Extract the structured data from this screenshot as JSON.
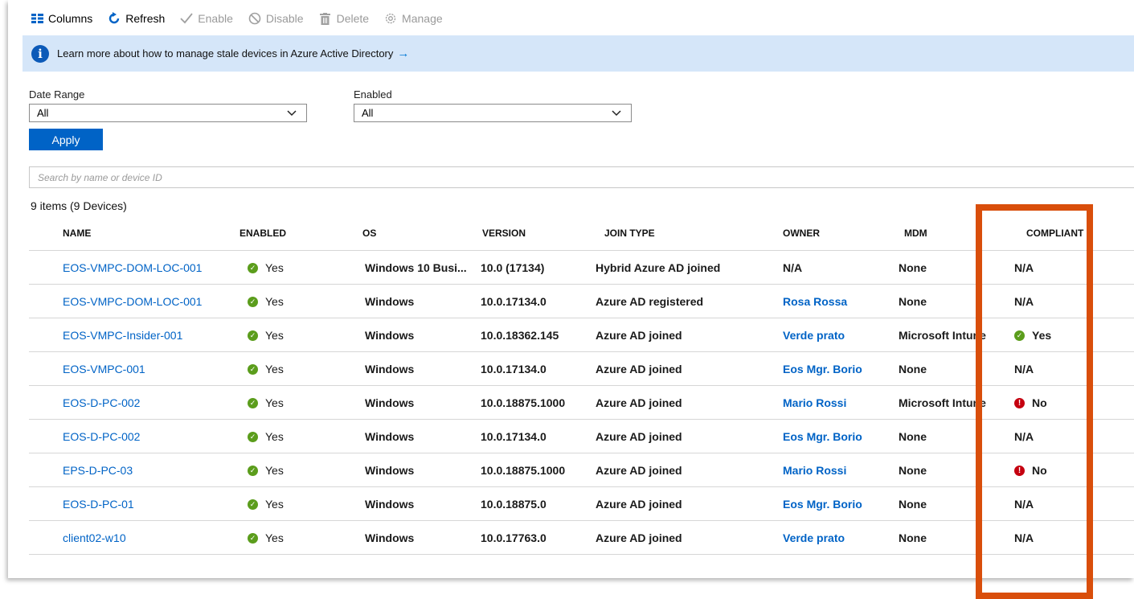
{
  "toolbar": {
    "columns": "Columns",
    "refresh": "Refresh",
    "enable": "Enable",
    "disable": "Disable",
    "delete": "Delete",
    "manage": "Manage"
  },
  "banner": {
    "text": "Learn more about how to manage stale devices in Azure Active Directory",
    "arrow": "→"
  },
  "filters": {
    "date_range_label": "Date Range",
    "date_range_value": "All",
    "enabled_label": "Enabled",
    "enabled_value": "All",
    "apply": "Apply"
  },
  "search": {
    "placeholder": "Search by name or device ID"
  },
  "count": "9 items (9 Devices)",
  "columns": [
    "NAME",
    "ENABLED",
    "OS",
    "VERSION",
    "JOIN TYPE",
    "OWNER",
    "MDM",
    "COMPLIANT"
  ],
  "rows": [
    {
      "name": "EOS-VMPC-DOM-LOC-001",
      "enabled": "Yes",
      "os": "Windows 10 Busi...",
      "version": "10.0 (17134)",
      "join": "Hybrid Azure AD joined",
      "owner": "N/A",
      "owner_link": false,
      "mdm": "None",
      "compliant": "N/A",
      "compliant_status": "none"
    },
    {
      "name": "EOS-VMPC-DOM-LOC-001",
      "enabled": "Yes",
      "os": "Windows",
      "version": "10.0.17134.0",
      "join": "Azure AD registered",
      "owner": "Rosa Rossa",
      "owner_link": true,
      "mdm": "None",
      "compliant": "N/A",
      "compliant_status": "none"
    },
    {
      "name": "EOS-VMPC-Insider-001",
      "enabled": "Yes",
      "os": "Windows",
      "version": "10.0.18362.145",
      "join": "Azure AD joined",
      "owner": "Verde prato",
      "owner_link": true,
      "mdm": "Microsoft Intune",
      "compliant": "Yes",
      "compliant_status": "ok"
    },
    {
      "name": "EOS-VMPC-001",
      "enabled": "Yes",
      "os": "Windows",
      "version": "10.0.17134.0",
      "join": "Azure AD joined",
      "owner": "Eos Mgr. Borio",
      "owner_link": true,
      "mdm": "None",
      "compliant": "N/A",
      "compliant_status": "none"
    },
    {
      "name": "EOS-D-PC-002",
      "enabled": "Yes",
      "os": "Windows",
      "version": "10.0.18875.1000",
      "join": "Azure AD joined",
      "owner": "Mario Rossi",
      "owner_link": true,
      "mdm": "Microsoft Intune",
      "compliant": "No",
      "compliant_status": "bad"
    },
    {
      "name": "EOS-D-PC-002",
      "enabled": "Yes",
      "os": "Windows",
      "version": "10.0.17134.0",
      "join": "Azure AD joined",
      "owner": "Eos Mgr. Borio",
      "owner_link": true,
      "mdm": "None",
      "compliant": "N/A",
      "compliant_status": "none"
    },
    {
      "name": "EPS-D-PC-03",
      "enabled": "Yes",
      "os": "Windows",
      "version": "10.0.18875.1000",
      "join": "Azure AD joined",
      "owner": "Mario Rossi",
      "owner_link": true,
      "mdm": "None",
      "compliant": "No",
      "compliant_status": "bad"
    },
    {
      "name": "EOS-D-PC-01",
      "enabled": "Yes",
      "os": "Windows",
      "version": "10.0.18875.0",
      "join": "Azure AD joined",
      "owner": "Eos Mgr. Borio",
      "owner_link": true,
      "mdm": "None",
      "compliant": "N/A",
      "compliant_status": "none"
    },
    {
      "name": "client02-w10",
      "enabled": "Yes",
      "os": "Windows",
      "version": "10.0.17763.0",
      "join": "Azure AD joined",
      "owner": "Verde prato",
      "owner_link": true,
      "mdm": "None",
      "compliant": "N/A",
      "compliant_status": "none"
    }
  ],
  "colors": {
    "accent": "#0063c6",
    "banner_bg": "#d5e6f9",
    "ok": "#5b9d1c",
    "bad": "#c5000f",
    "highlight": "#d94e0b"
  }
}
